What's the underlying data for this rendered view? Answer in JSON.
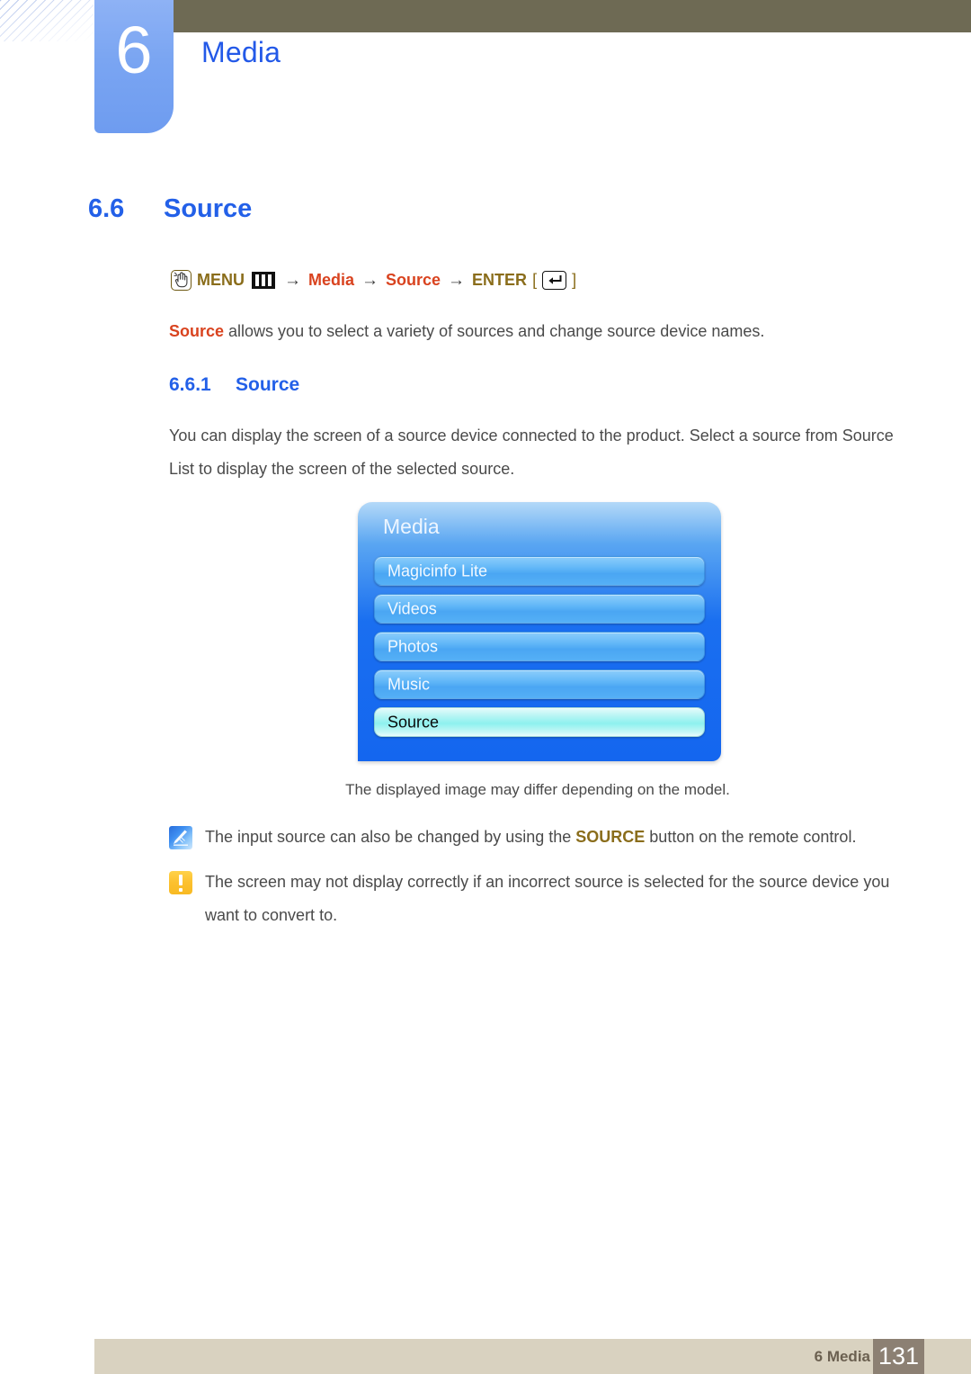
{
  "chapter": {
    "number": "6",
    "title": "Media"
  },
  "section": {
    "number": "6.6",
    "title": "Source"
  },
  "subsection": {
    "number": "6.6.1",
    "title": "Source"
  },
  "path": {
    "hand_icon": "hand-pointer-icon",
    "menu_label": "MENU",
    "menu_icon": "menu-bars-icon",
    "arrow1": "→",
    "media_label": "Media",
    "arrow2": "→",
    "source_label": "Source",
    "arrow3": "→",
    "enter_label": "ENTER",
    "bracket_open": "[",
    "enter_icon": "enter-key-icon",
    "bracket_close": "]"
  },
  "intro": {
    "highlight": "Source",
    "text": " allows you to select a variety of sources and change source device names."
  },
  "body": {
    "text": "You can display the screen of a source device connected to the product. Select a source from Source List to display the screen of the selected source."
  },
  "osd": {
    "title": "Media",
    "items": [
      {
        "label": "Magicinfo Lite",
        "selected": false
      },
      {
        "label": "Videos",
        "selected": false
      },
      {
        "label": "Photos",
        "selected": false
      },
      {
        "label": "Music",
        "selected": false
      },
      {
        "label": "Source",
        "selected": true
      }
    ]
  },
  "caption": {
    "text": "The displayed image may differ depending on the model."
  },
  "notes": [
    {
      "icon": "note-pen-icon",
      "text_before": "The input source can also be changed by using the ",
      "highlight": "SOURCE",
      "text_after": " button on the remote control."
    },
    {
      "icon": "caution-exclamation-icon",
      "text_before": "The screen may not display correctly if an incorrect source is selected for the source device you want to convert to.",
      "highlight": "",
      "text_after": ""
    }
  ],
  "footer": {
    "label": "6 Media",
    "page": "131"
  },
  "colors": {
    "heading_blue": "#2360e8",
    "accent_red": "#d9431f",
    "accent_olive": "#8a6d1b",
    "topbar": "#6e6a54",
    "footer_band": "#d9d2c0",
    "footer_page_box": "#8c8073",
    "osd_blue": "#1466ef",
    "osd_selected": "#8ef1ef"
  }
}
